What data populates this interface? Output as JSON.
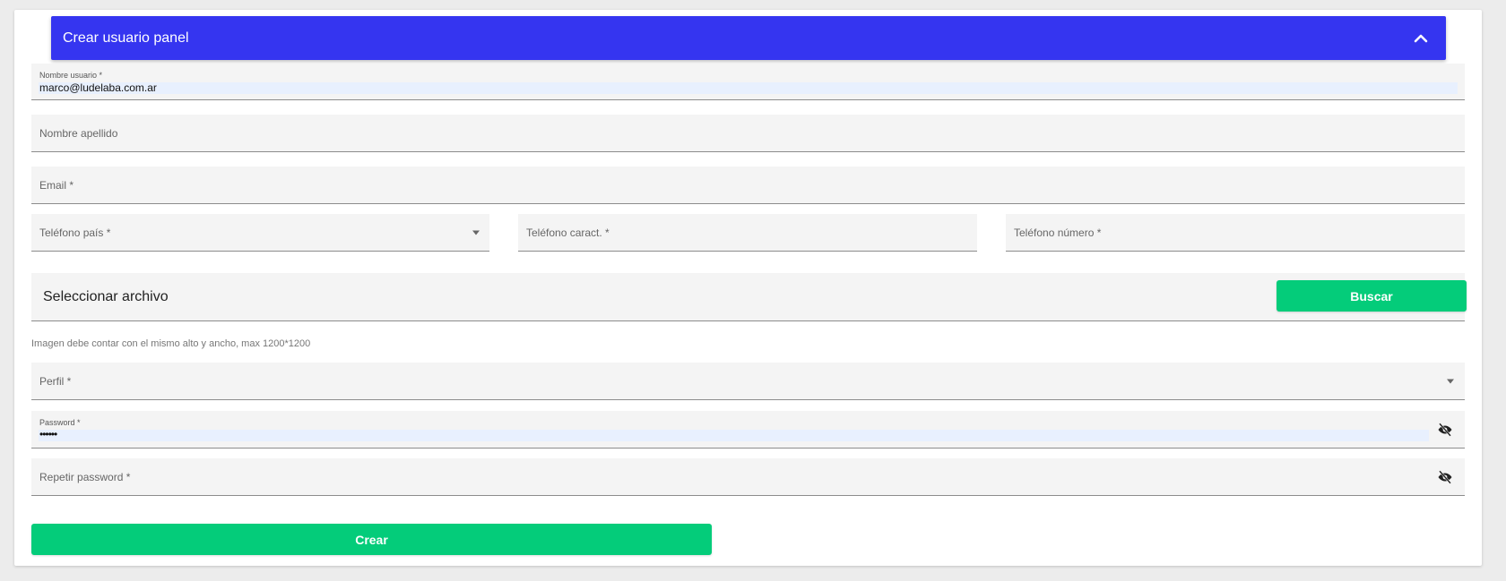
{
  "panel": {
    "title": "Crear usuario panel"
  },
  "fields": {
    "username": {
      "label": "Nombre usuario *",
      "value": "marco@ludelaba.com.ar"
    },
    "full_name": {
      "label": "Nombre apellido"
    },
    "email": {
      "label": "Email *"
    },
    "phone_country": {
      "label": "Teléfono país *"
    },
    "phone_area": {
      "label": "Teléfono caract. *"
    },
    "phone_number": {
      "label": "Teléfono número *"
    },
    "profile": {
      "label": "Perfil *"
    },
    "password": {
      "label": "Password *",
      "value": "••••••"
    },
    "repeat_password": {
      "label": "Repetir password *"
    }
  },
  "file": {
    "title": "Seleccionar archivo",
    "button_label": "Buscar",
    "hint": "Imagen debe contar con el mismo alto y ancho, max 1200*1200"
  },
  "submit": {
    "label": "Crear"
  },
  "colors": {
    "header": "#3535f0",
    "primary_button": "#04cc7a",
    "field_bg": "#f4f4f4"
  },
  "icons": {
    "collapse": "chevron-up-icon",
    "select": "caret-down-icon",
    "visibility": "eye-off-icon"
  }
}
